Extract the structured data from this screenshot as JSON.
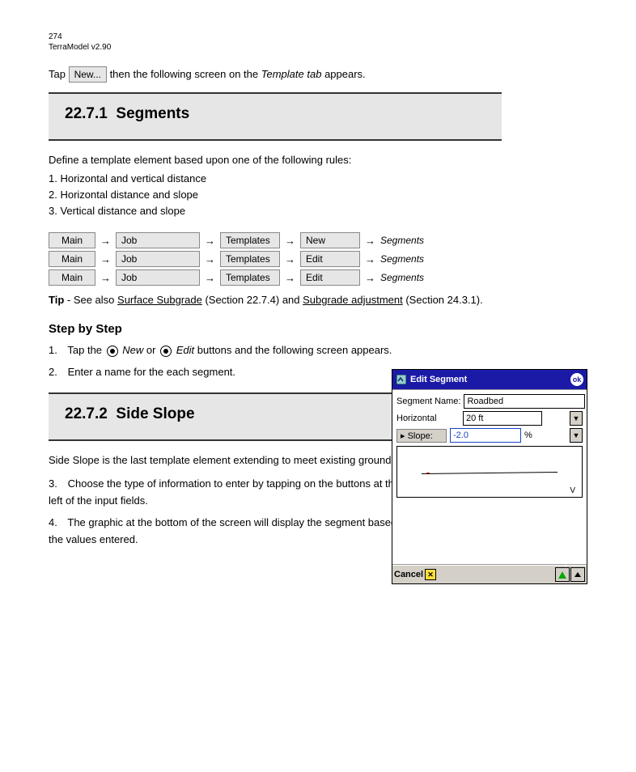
{
  "header": {
    "page_number": "274",
    "doc_title": "TerraModel v2.90"
  },
  "intro": {
    "button_new": "New...",
    "text_before": "Tap ",
    "text_after": " then the following screen on the ",
    "screen_ref_italic": "Template tab",
    "text_end": " appears."
  },
  "section1": {
    "title": "22.7.1",
    "subtitle": "Segments"
  },
  "define_para": "Define a template element based upon one of the following rules:",
  "segment_types": {
    "row1": "1. Horizontal and vertical distance",
    "row2": "2. Horizontal distance and slope",
    "row3": "3. Vertical distance and slope"
  },
  "breadcrumbs": {
    "b1": {
      "main": "Main",
      "job": "Job",
      "templates": "Templates",
      "new": "New",
      "segments": "Segments"
    },
    "b2": {
      "main": "Main",
      "job": "Job",
      "templates": "Templates",
      "edit": "Edit",
      "segments": "Segments"
    }
  },
  "tip": {
    "label": "Tip",
    "before": " - See also ",
    "link1": "Surface Subgrade",
    "between": " (Section 22.7.4) and ",
    "link2": "Subgrade adjustment",
    "after": " (Section 24.3.1)."
  },
  "steps": {
    "heading": "Step by Step",
    "s1_num": "1.",
    "s1_before": "Tap the ",
    "s1_radio1": "New",
    "s1_middle": " or ",
    "s1_radio2": "Edit",
    "s1_after": " buttons and the following screen appears.",
    "s2_num": "2.",
    "s2_text": "Enter a name for the each segment.",
    "s3_num": "3.",
    "s3_text": "Choose the type of information to enter by tapping on the buttons at the left of the input fields.",
    "s4_num": "4.",
    "s4_text": "The graphic at the bottom of the screen will display the segment based on the values entered."
  },
  "section2": {
    "title": "22.7.2",
    "subtitle": "Side Slope"
  },
  "slope_para": "Side Slope is the last template element extending to meet existing ground.",
  "dialog": {
    "title": "Edit Segment",
    "ok_label": "ok",
    "seg_name_label": "Segment Name:",
    "seg_name_value": "Roadbed",
    "horiz_label": "Horizontal",
    "horiz_value": "20 ft",
    "slope_label": "▸ Slope:",
    "slope_value": "-2.0",
    "slope_unit": "%",
    "canvas_v": "V",
    "cancel": "Cancel"
  }
}
